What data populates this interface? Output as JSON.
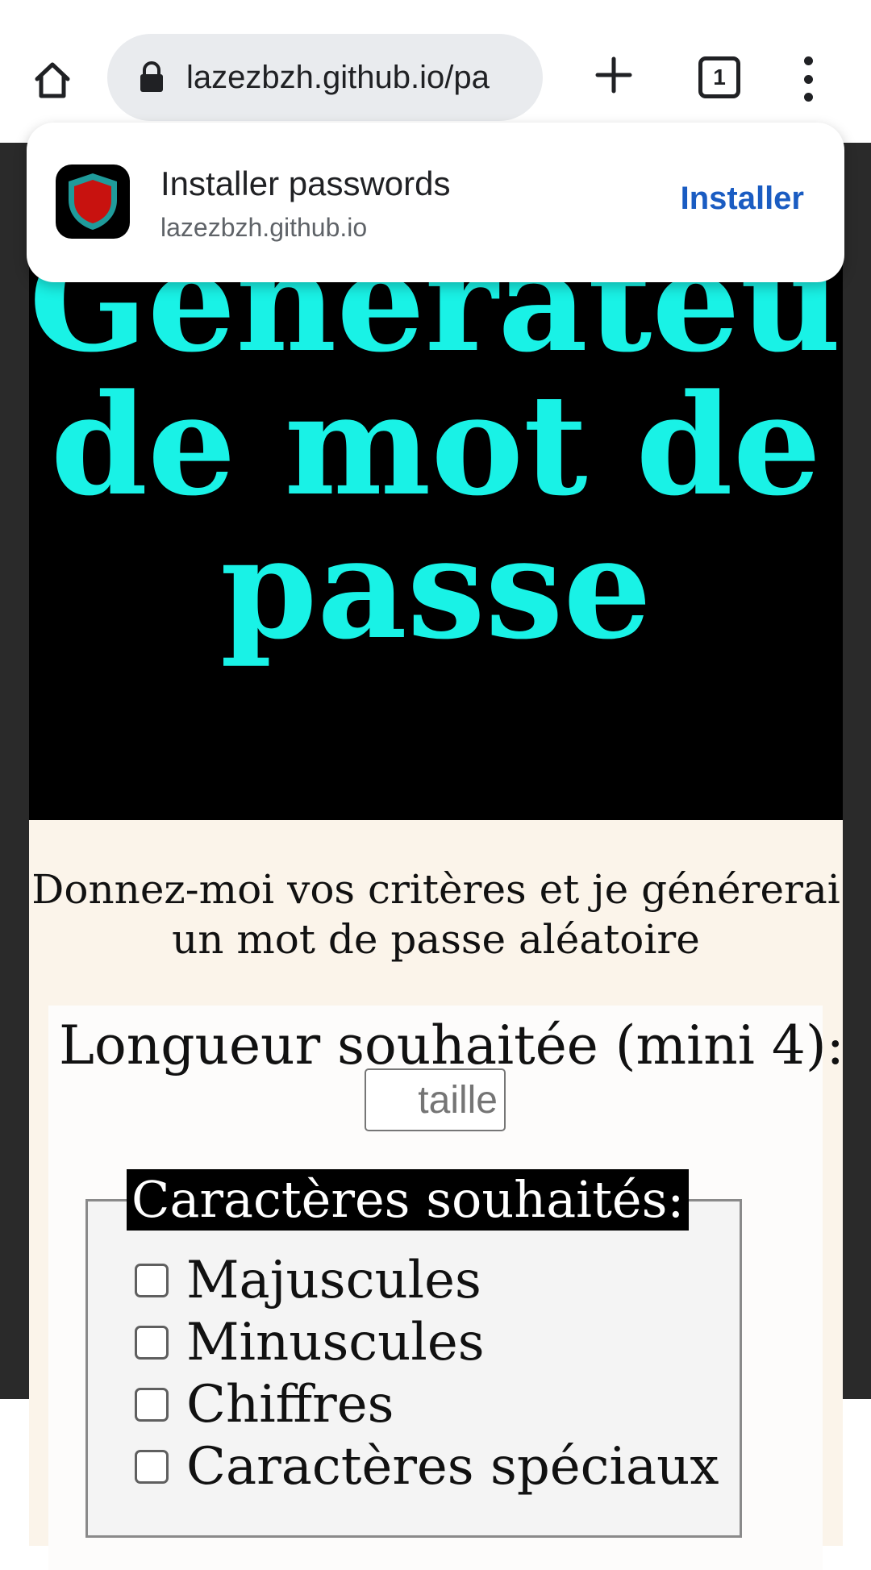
{
  "browser": {
    "url": "lazezbzh.github.io/pa",
    "tab_count": "1",
    "icons": {
      "home": "home-icon",
      "lock": "lock-icon",
      "new_tab": "plus-icon",
      "menu": "more-vert-icon"
    }
  },
  "install_prompt": {
    "title": "Installer passwords",
    "origin": "lazezbzh.github.io",
    "button_label": "Installer",
    "icon": "shield-icon",
    "colors": {
      "accent": "#1a5cc2",
      "shield_fill": "#c8120f",
      "shield_border": "#1f9b9b"
    }
  },
  "page": {
    "title_lines": [
      "Générateur",
      "de mot de",
      "passe"
    ],
    "intro": "Donnez-moi vos critères et je générerai un mot de passe aléatoire",
    "length": {
      "label": "Longueur souhaitée (mini 4):",
      "placeholder": "taille"
    },
    "characters": {
      "legend": "Caractères souhaités:",
      "options": [
        {
          "label": "Majuscules",
          "checked": false
        },
        {
          "label": "Minuscules",
          "checked": false
        },
        {
          "label": "Chiffres",
          "checked": false
        },
        {
          "label": "Caractères spéciaux",
          "checked": false
        }
      ]
    },
    "colors": {
      "title": "#19f2e6",
      "hero_background": "#000000",
      "content_background": "#fbf4ea"
    }
  }
}
